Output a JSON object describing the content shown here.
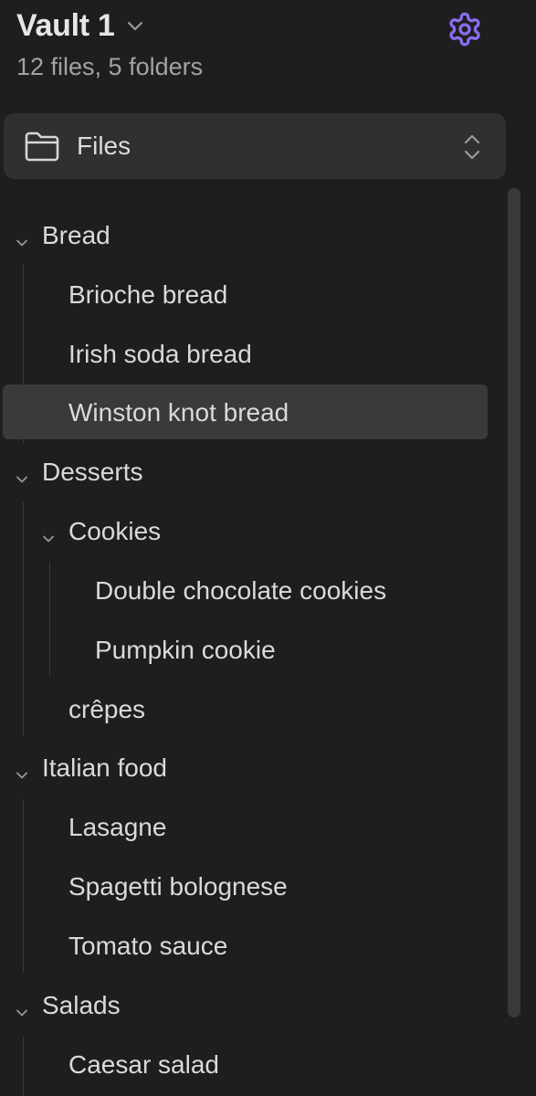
{
  "vault": {
    "name": "Vault 1",
    "stats": "12 files, 5 folders"
  },
  "view_selector": {
    "label": "Files"
  },
  "tree": {
    "bread": {
      "label": "Bread",
      "items": [
        "Brioche bread",
        "Irish soda bread",
        "Winston knot bread"
      ]
    },
    "desserts": {
      "label": "Desserts",
      "cookies": {
        "label": "Cookies",
        "items": [
          "Double chocolate cookies",
          "Pumpkin cookie"
        ]
      },
      "items": [
        "crêpes"
      ]
    },
    "italian": {
      "label": "Italian food",
      "items": [
        "Lasagne",
        "Spagetti bolognese",
        "Tomato sauce"
      ]
    },
    "salads": {
      "label": "Salads",
      "items": [
        "Caesar salad"
      ]
    }
  },
  "selected_item": "Winston knot bread",
  "icons": {
    "vault_chevron": "chevron-down-icon",
    "settings": "gear-icon",
    "view_folder": "folder-icon",
    "view_updown": "chevron-up-down-icon",
    "folder_caret": "chevron-down-icon"
  },
  "colors": {
    "background": "#1e1e1e",
    "accent": "#8b6cef",
    "selected_row": "#3a3a3a",
    "selector_bg": "#303030"
  }
}
